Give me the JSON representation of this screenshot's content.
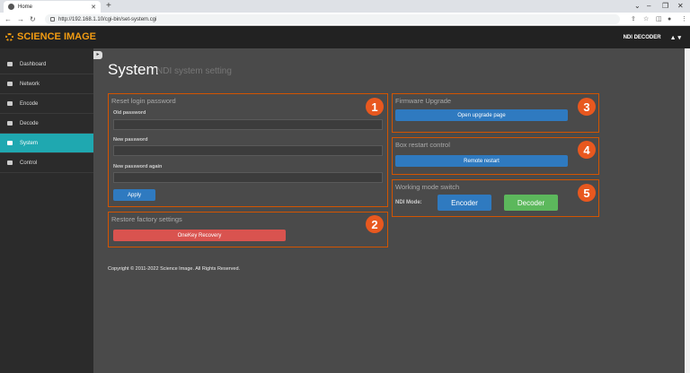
{
  "browser": {
    "tab_title": "Home",
    "url": "http://192.168.1.10/cgi-bin/set-system.cgi"
  },
  "header": {
    "brand": "SCIENCE IMAGE",
    "device": "NDI DECODER",
    "user_caret": "▲ ▾"
  },
  "sidebar": {
    "items": [
      {
        "label": "Dashboard",
        "icon": "dashboard-icon"
      },
      {
        "label": "Network",
        "icon": "network-icon"
      },
      {
        "label": "Encode",
        "icon": "encode-icon"
      },
      {
        "label": "Decode",
        "icon": "decode-icon"
      },
      {
        "label": "System",
        "icon": "system-icon",
        "active": true
      },
      {
        "label": "Control",
        "icon": "control-icon"
      }
    ]
  },
  "page": {
    "title": "System",
    "subtitle": "NDI system setting"
  },
  "reset_password": {
    "title": "Reset login password",
    "old_label": "Old password",
    "new_label": "New password",
    "again_label": "New password again",
    "apply": "Apply",
    "badge": "1"
  },
  "factory": {
    "title": "Restore factory settings",
    "button": "OneKey Recovery",
    "badge": "2"
  },
  "firmware": {
    "title": "Firmware Upgrade",
    "button": "Open upgrade page",
    "badge": "3"
  },
  "restart": {
    "title": "Box restart control",
    "button": "Remote restart",
    "badge": "4"
  },
  "mode": {
    "title": "Working mode switch",
    "label": "NDI Mode:",
    "encoder": "Encoder",
    "decoder": "Decoder",
    "badge": "5"
  },
  "footer": {
    "copyright": "Copyright © 2011-2022 Science Image. All Rights Reserved."
  },
  "colors": {
    "accent": "#1fa8b0",
    "brand": "#f39c12",
    "panel_border": "#d35400",
    "badge": "#e8581f"
  }
}
